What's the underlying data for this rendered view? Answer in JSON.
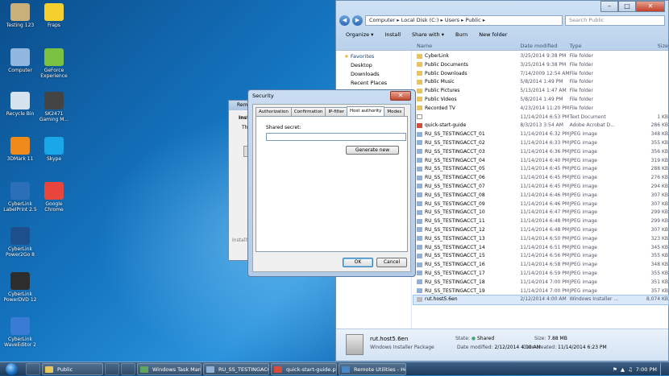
{
  "desktop": {
    "icons": [
      {
        "label": "Testing 123",
        "color": "#c9b07a"
      },
      {
        "label": "Fraps",
        "color": "#f3d02e"
      },
      {
        "label": "Computer",
        "color": "#8fb7e0"
      },
      {
        "label": "GeForce Experience",
        "color": "#7cc242"
      },
      {
        "label": "Recycle Bin",
        "color": "#d5e3ef"
      },
      {
        "label": "SK2471 Gaming M...",
        "color": "#444"
      },
      {
        "label": "3DMark 11",
        "color": "#f08a1a"
      },
      {
        "label": "Skype",
        "color": "#1aa6e8"
      },
      {
        "label": "CyberLink LabelPrint 2.5",
        "color": "#2b6fb8"
      },
      {
        "label": "Google Chrome",
        "color": "#e8453c"
      },
      {
        "label": "CyberLink Power2Go 8",
        "color": "#1d4f8c"
      },
      {
        "label": "CyberLink PowerDVD 12",
        "color": "#2d2d2d"
      },
      {
        "label": "CyberLink WaveEditor 2",
        "color": "#3a7bd5"
      }
    ]
  },
  "explorer": {
    "address": "Computer ▸ Local Disk (C:) ▸ Users ▸ Public ▸",
    "search_placeholder": "Search Public",
    "toolbar": [
      "Organize ▾",
      "Install",
      "Share with ▾",
      "Burn",
      "New folder"
    ],
    "columns": [
      "Name",
      "Date modified",
      "Type",
      "Size"
    ],
    "nav": {
      "favorites": "Favorites",
      "items": [
        "Desktop",
        "Downloads",
        "Recent Places"
      ]
    },
    "files": [
      {
        "name": "CyberLink",
        "date": "3/25/2014 9:38 PM",
        "type": "File folder",
        "size": "",
        "kind": "folder"
      },
      {
        "name": "Public Documents",
        "date": "3/25/2014 9:38 PM",
        "type": "File folder",
        "size": "",
        "kind": "folder"
      },
      {
        "name": "Public Downloads",
        "date": "7/14/2009 12:54 AM",
        "type": "File folder",
        "size": "",
        "kind": "folder"
      },
      {
        "name": "Public Music",
        "date": "5/8/2014 1:49 PM",
        "type": "File folder",
        "size": "",
        "kind": "folder"
      },
      {
        "name": "Public Pictures",
        "date": "5/13/2014 1:47 AM",
        "type": "File folder",
        "size": "",
        "kind": "folder"
      },
      {
        "name": "Public Videos",
        "date": "5/8/2014 1:49 PM",
        "type": "File folder",
        "size": "",
        "kind": "folder"
      },
      {
        "name": "Recorded TV",
        "date": "4/23/2014 11:20 PM",
        "type": "File folder",
        "size": "",
        "kind": "folder"
      },
      {
        "name": "",
        "date": "11/14/2014 6:53 PM",
        "type": "Text Document",
        "size": "1 KB",
        "kind": "doc"
      },
      {
        "name": "quick-start-guide",
        "date": "8/3/2013 3:54 AM",
        "type": "Adobe Acrobat D...",
        "size": "286 KB",
        "kind": "pdf"
      },
      {
        "name": "RU_SS_TESTINGACCT_01",
        "date": "11/14/2014 6:32 PM",
        "type": "JPEG image",
        "size": "348 KB",
        "kind": "img"
      },
      {
        "name": "RU_SS_TESTINGACCT_02",
        "date": "11/14/2014 6:33 PM",
        "type": "JPEG image",
        "size": "355 KB",
        "kind": "img"
      },
      {
        "name": "RU_SS_TESTINGACCT_03",
        "date": "11/14/2014 6:36 PM",
        "type": "JPEG image",
        "size": "356 KB",
        "kind": "img"
      },
      {
        "name": "RU_SS_TESTINGACCT_04",
        "date": "11/14/2014 6:40 PM",
        "type": "JPEG image",
        "size": "319 KB",
        "kind": "img"
      },
      {
        "name": "RU_SS_TESTINGACCT_05",
        "date": "11/14/2014 6:45 PM",
        "type": "JPEG image",
        "size": "288 KB",
        "kind": "img"
      },
      {
        "name": "RU_SS_TESTINGACCT_06",
        "date": "11/14/2014 6:45 PM",
        "type": "JPEG image",
        "size": "276 KB",
        "kind": "img"
      },
      {
        "name": "RU_SS_TESTINGACCT_07",
        "date": "11/14/2014 6:45 PM",
        "type": "JPEG image",
        "size": "294 KB",
        "kind": "img"
      },
      {
        "name": "RU_SS_TESTINGACCT_08",
        "date": "11/14/2014 6:46 PM",
        "type": "JPEG image",
        "size": "307 KB",
        "kind": "img"
      },
      {
        "name": "RU_SS_TESTINGACCT_09",
        "date": "11/14/2014 6:46 PM",
        "type": "JPEG image",
        "size": "307 KB",
        "kind": "img"
      },
      {
        "name": "RU_SS_TESTINGACCT_10",
        "date": "11/14/2014 6:47 PM",
        "type": "JPEG image",
        "size": "299 KB",
        "kind": "img"
      },
      {
        "name": "RU_SS_TESTINGACCT_11",
        "date": "11/14/2014 6:48 PM",
        "type": "JPEG image",
        "size": "299 KB",
        "kind": "img"
      },
      {
        "name": "RU_SS_TESTINGACCT_12",
        "date": "11/14/2014 6:48 PM",
        "type": "JPEG image",
        "size": "307 KB",
        "kind": "img"
      },
      {
        "name": "RU_SS_TESTINGACCT_13",
        "date": "11/14/2014 6:50 PM",
        "type": "JPEG image",
        "size": "323 KB",
        "kind": "img"
      },
      {
        "name": "RU_SS_TESTINGACCT_14",
        "date": "11/14/2014 6:51 PM",
        "type": "JPEG image",
        "size": "345 KB",
        "kind": "img"
      },
      {
        "name": "RU_SS_TESTINGACCT_15",
        "date": "11/14/2014 6:56 PM",
        "type": "JPEG image",
        "size": "355 KB",
        "kind": "img"
      },
      {
        "name": "RU_SS_TESTINGACCT_16",
        "date": "11/14/2014 6:58 PM",
        "type": "JPEG image",
        "size": "348 KB",
        "kind": "img"
      },
      {
        "name": "RU_SS_TESTINGACCT_17",
        "date": "11/14/2014 6:59 PM",
        "type": "JPEG image",
        "size": "355 KB",
        "kind": "img"
      },
      {
        "name": "RU_SS_TESTINGACCT_18",
        "date": "11/14/2014 7:00 PM",
        "type": "JPEG image",
        "size": "351 KB",
        "kind": "img"
      },
      {
        "name": "RU_SS_TESTINGACCT_19",
        "date": "11/14/2014 7:00 PM",
        "type": "JPEG image",
        "size": "357 KB",
        "kind": "img"
      },
      {
        "name": "rut.host5.6en",
        "date": "2/12/2014 4:00 AM",
        "type": "Windows Installer ...",
        "size": "8,074 KB",
        "kind": "msi",
        "selected": true
      }
    ],
    "details": {
      "name": "rut.host5.6en",
      "type": "Windows Installer Package",
      "state_label": "State:",
      "state": "Shared",
      "size_label": "Size:",
      "size": "7.88 MB",
      "modified_label": "Date modified:",
      "modified": "2/12/2014 4:00 AM",
      "created_label": "Date created:",
      "created": "11/14/2014 6:23 PM"
    }
  },
  "bg_window": {
    "title": "Remo",
    "line1": "Inst",
    "line2": "The",
    "footer": "InstallS"
  },
  "dialog": {
    "title": "Security",
    "tabs": [
      "Authorization",
      "Confirmation",
      "IP-filter",
      "Host authority",
      "Modes"
    ],
    "active_tab": 3,
    "secret_label": "Shared secret:",
    "secret_value": "",
    "generate_label": "Generate new",
    "ok_label": "OK",
    "cancel_label": "Cancel"
  },
  "taskbar": {
    "items": [
      "Public",
      "Windows Task Mana...",
      "RU_SS_TESTINGACC...",
      "quick-start-guide.pd...",
      "Remote Utilities - Ho..."
    ],
    "clock": "7:00 PM"
  }
}
